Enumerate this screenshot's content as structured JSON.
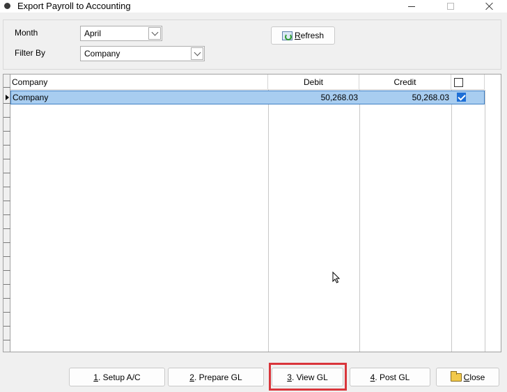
{
  "window": {
    "title": "Export Payroll to Accounting"
  },
  "filters": {
    "month_label": "Month",
    "month_value": "April",
    "filter_by_label": "Filter By",
    "filter_by_value": "Company",
    "refresh_label_accel": "R",
    "refresh_label_rest": "efresh"
  },
  "grid": {
    "columns": [
      "Company",
      "Debit",
      "Credit"
    ],
    "rows": [
      {
        "company": "Company",
        "debit": "50,268.03",
        "credit": "50,268.03",
        "checked": true
      }
    ]
  },
  "actions": {
    "setup_num": "1",
    "setup_rest": ". Setup A/C",
    "prepare_num": "2",
    "prepare_rest": ". Prepare GL",
    "view_num": "3",
    "view_rest": ". View GL",
    "post_num": "4",
    "post_rest": ". Post GL",
    "close_accel": "C",
    "close_rest": "lose"
  },
  "colors": {
    "selection": "#a8cdf0",
    "highlight_border": "#d9353b",
    "checkbox": "#1e6fd6"
  }
}
